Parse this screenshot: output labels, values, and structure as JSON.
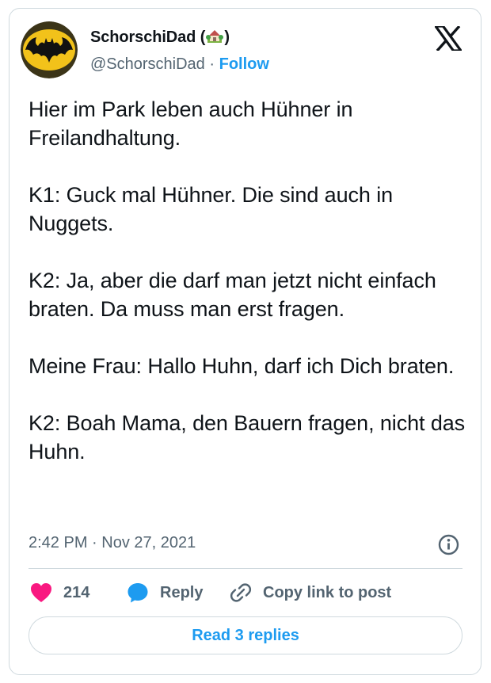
{
  "author": {
    "display_name": "SchorschiDad",
    "name_open": "(",
    "name_close": ")",
    "name_emoji": "house-with-garden-icon",
    "handle": "@SchorschiDad",
    "separator": "·",
    "follow_label": "Follow"
  },
  "brand": {
    "logo": "x-logo-icon"
  },
  "tweet": {
    "paragraphs": [
      "Hier im Park leben auch Hühner in Freilandhaltung.",
      "K1: Guck mal Hühner. Die sind auch in Nuggets.",
      "K2: Ja, aber die darf man jetzt nicht einfach braten. Da muss man erst fragen.",
      "Meine Frau: Hallo Huhn, darf ich Dich braten.",
      "K2: Boah Mama, den Bauern fragen, nicht das Huhn."
    ],
    "timestamp": "2:42 PM · Nov 27, 2021"
  },
  "actions": {
    "like_count": "214",
    "reply_label": "Reply",
    "copy_label": "Copy link to post",
    "read_replies_label": "Read 3 replies"
  },
  "colors": {
    "accent": "#1d9bf0",
    "like": "#f91880",
    "muted": "#536471",
    "text": "#0f1419",
    "border": "#cfd9de"
  }
}
